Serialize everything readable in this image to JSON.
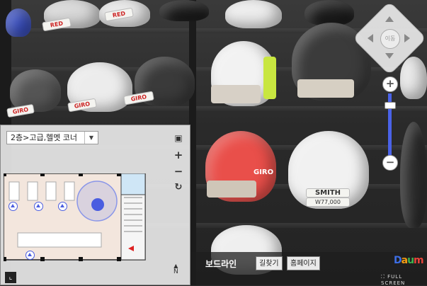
{
  "pano": {
    "tags": [
      "RED",
      "RED",
      "GIRO",
      "GIRO",
      "GIRO",
      "SMITH",
      "W77,000"
    ],
    "brand_on_helmet": "GIRO"
  },
  "navigation": {
    "compass_center_label": "이동",
    "zoom_in_label": "+",
    "zoom_out_label": "−",
    "zoom_level": 0.88
  },
  "minimap": {
    "floor_selected": "2층>고급,헬멧 코너",
    "floor_dropdown_icon": "caret-down-icon",
    "expand_icon": "expand-icon",
    "zoom_in_label": "+",
    "zoom_out_label": "−",
    "rotate_icon": "rotate-icon",
    "corner_icon": "collapse-corner-icon",
    "north_label": "N"
  },
  "infobar": {
    "place_name": "보드라인",
    "directions_button": "길찾기",
    "homepage_button": "홈페이지",
    "logo_text": "Daum",
    "fullscreen_label": "FULL SCREEN"
  },
  "colors": {
    "accent_blue": "#4a5de0",
    "logo_orange": "#f39c12"
  }
}
